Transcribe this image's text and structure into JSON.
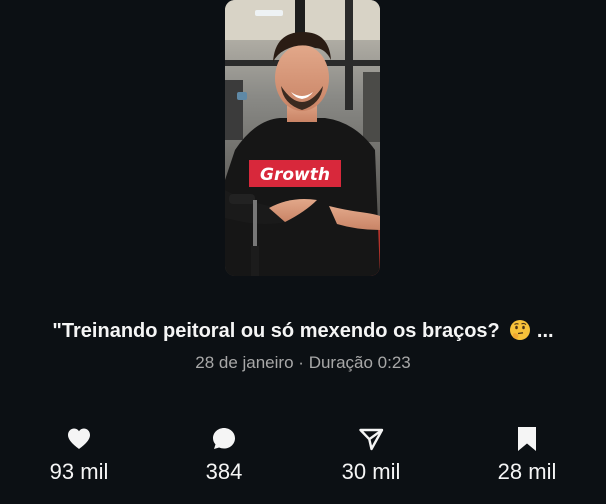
{
  "post": {
    "thumbnail": {
      "shirt_text": "Growth",
      "shirt_color": "#151515",
      "shirt_badge_color": "#d8283b"
    },
    "caption": "\"Treinando peitoral ou só mexendo os braços?",
    "caption_emoji": "thinking-face-icon",
    "caption_ellipsis": "...",
    "date": "28 de janeiro",
    "separator": "·",
    "duration": "Duração 0:23"
  },
  "stats": {
    "likes": {
      "icon": "heart-icon",
      "value": "93 mil"
    },
    "comments": {
      "icon": "comment-icon",
      "value": "384"
    },
    "shares": {
      "icon": "send-icon",
      "value": "30 mil"
    },
    "saves": {
      "icon": "bookmark-icon",
      "value": "28 mil"
    }
  },
  "colors": {
    "background": "#0c1014",
    "text_primary": "#f5f5f5",
    "text_secondary": "#a8a8a8"
  }
}
